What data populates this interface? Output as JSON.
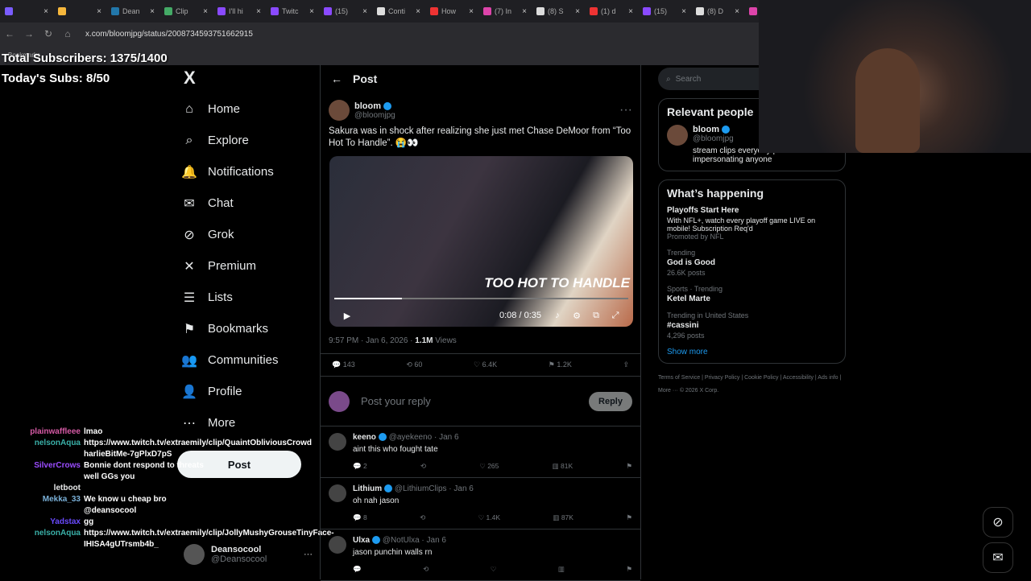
{
  "browser": {
    "tabs": [
      "",
      "",
      "Dean",
      "Clip",
      "I'll hi",
      "Twitc",
      "(15)",
      "Conti",
      "How",
      "(7) In",
      "(8) S",
      "(1) d",
      "(15)",
      "(8) D",
      "(7) In"
    ],
    "url": "x.com/bloomjpg/status/2008734593751662915",
    "bookmarks": "Bookmarks"
  },
  "overlay": {
    "total": "Total Subscribers: 1375/1400",
    "today": "Today's Subs: 8/50"
  },
  "nav": {
    "logo": "X",
    "items": [
      "Home",
      "Explore",
      "Notifications",
      "Chat",
      "Grok",
      "Premium",
      "Lists",
      "Bookmarks",
      "Communities",
      "Profile",
      "More"
    ],
    "post": "Post"
  },
  "profile": {
    "name": "Deansocool",
    "handle": "@Deansocool"
  },
  "chat": [
    {
      "name": "plainwaffleee",
      "color": "#d65aa5",
      "msg": "lmao"
    },
    {
      "name": "nelsonAqua",
      "color": "#3ab0a8",
      "msg": "https://www.twitch.tv/extraemily/clip/QuaintObliviousCrowd harlieBitMe-7gPlxD7pS"
    },
    {
      "name": "SilverCrows",
      "color": "#9b4dff",
      "msg": "Bonnie dont respond to threats well GGs you"
    },
    {
      "name": "letboot",
      "color": "#e7e9ea",
      "msg": ""
    },
    {
      "name": "Mekka_33",
      "color": "#7ab0d8",
      "msg": "We know u cheap bro @deansocool"
    },
    {
      "name": "Yadstax",
      "color": "#6a4aff",
      "msg": "gg"
    },
    {
      "name": "nelsonAqua",
      "color": "#3ab0a8",
      "msg": "https://www.twitch.tv/extraemily/clip/JollyMushyGrouseTinyFace-IHISA4gUTrsmb4b_"
    }
  ],
  "main": {
    "header": "Post",
    "tweet": {
      "name": "bloom",
      "handle": "@bloomjpg",
      "text": "Sakura was in shock after realizing she just met Chase DeMoor from “Too Hot To Handle”. 😭👀",
      "video_overlay": "TOO HOT TO HANDLE",
      "video_time": "0:08 / 0:35",
      "progress": 0.23,
      "time": "9:57 PM · Jan 6, 2026 · ",
      "views": "1.1M",
      "views_label": "Views",
      "replies": "143",
      "reposts": "60",
      "likes": "6.4K",
      "bookmarks": "1.2K"
    },
    "reply_placeholder": "Post your reply",
    "reply_button": "Reply",
    "replies": [
      {
        "name": "keeno",
        "handle": "@ayekeeno · Jan 6",
        "text": "aint this who fought tate",
        "r": "2",
        "l": "265",
        "v": "81K"
      },
      {
        "name": "Lithium",
        "handle": "@LithiumClips · Jan 6",
        "text": "oh nah jason",
        "r": "8",
        "l": "1.4K",
        "v": "87K"
      },
      {
        "name": "Ulxa",
        "handle": "@NotUlxa · Jan 6",
        "text": "jason punchin walls rn",
        "r": "",
        "l": "",
        "v": ""
      }
    ]
  },
  "right": {
    "search": "Search",
    "relevant": "Relevant people",
    "person": {
      "name": "bloom",
      "handle": "@bloomjpg",
      "bio": "stream clips everyday | not impersonating anyone"
    },
    "happening": "What’s happening",
    "trends": [
      {
        "ctx": "",
        "title": "Playoffs Start Here",
        "desc": "With NFL+, watch every playoff game LIVE on mobile! Subscription Req'd",
        "posts": "Promoted by NFL"
      },
      {
        "ctx": "Trending",
        "title": "God is Good",
        "desc": "",
        "posts": "26.6K posts"
      },
      {
        "ctx": "Sports · Trending",
        "title": "Ketel Marte",
        "desc": "",
        "posts": ""
      },
      {
        "ctx": "Trending in United States",
        "title": "#cassini",
        "desc": "",
        "posts": "4,296 posts"
      }
    ],
    "show_more": "Show more",
    "footer": "Terms of Service | Privacy Policy | Cookie Policy | Accessibility | Ads info | More ··· © 2026 X Corp."
  }
}
